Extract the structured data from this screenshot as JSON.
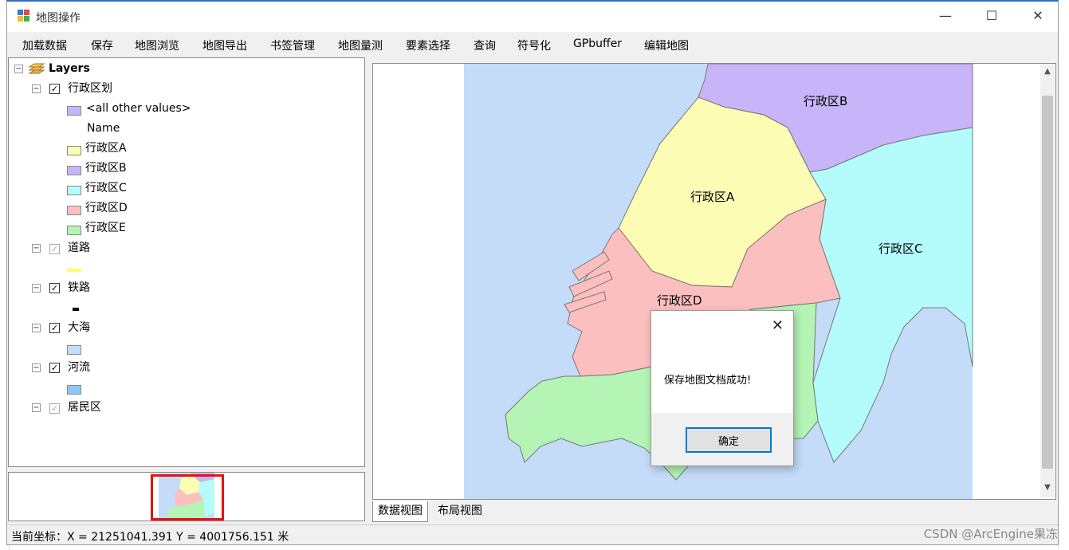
{
  "window": {
    "title": "地图操作"
  },
  "titlebar_buttons": {
    "minimize": "—",
    "maximize": "☐",
    "close": "✕"
  },
  "menu": [
    "加载数据",
    "保存",
    "地图浏览",
    "地图导出",
    "书签管理",
    "地图量测",
    "要素选择",
    "查询",
    "符号化",
    "GPbuffer",
    "编辑地图"
  ],
  "toc": {
    "root": "Layers",
    "admin_layer": {
      "name": "行政区划",
      "other_values": "<all other values>",
      "field": "Name",
      "classes": [
        {
          "label": "行政区A",
          "color": "#fcfcb4"
        },
        {
          "label": "行政区B",
          "color": "#c8b4f8"
        },
        {
          "label": "行政区C",
          "color": "#b4fcfc"
        },
        {
          "label": "行政区D",
          "color": "#fcbfbf"
        },
        {
          "label": "行政区E",
          "color": "#b4f4b4"
        }
      ]
    },
    "road_layer": "道路",
    "rail_layer": "铁路",
    "sea_layer": "大海",
    "river_layer": "河流",
    "residential_layer": "居民区"
  },
  "map": {
    "labels": {
      "a": "行政区A",
      "b": "行政区B",
      "c": "行政区C",
      "d": "行政区D"
    },
    "colors": {
      "sea": "#c4dcf8",
      "a": "#fcfcb4",
      "b": "#c8b4f8",
      "c": "#b4fcfc",
      "d": "#fcbfbf",
      "e": "#b4f4b4",
      "river": "#8cc8f8",
      "road": "#ffff66",
      "rail": "#000000"
    }
  },
  "tabs": [
    "数据视图",
    "布局视图"
  ],
  "status": "当前坐标：X = 21251041.391 Y = 4001756.151 米",
  "dialog": {
    "message": "保存地图文档成功!",
    "ok": "确定",
    "close": "✕"
  },
  "watermark": "CSDN @ArcEngine果冻"
}
